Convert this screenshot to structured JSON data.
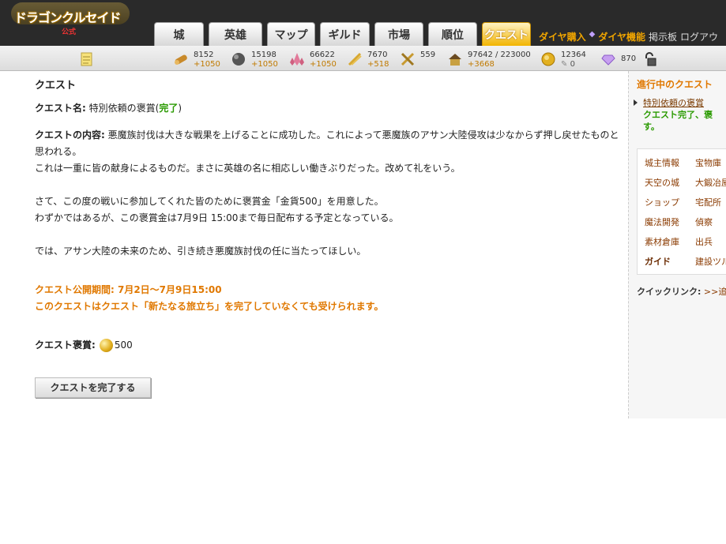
{
  "header": {
    "logo_text": "ドラゴンクルセイド",
    "logo_sub": "公式",
    "tabs": [
      "城",
      "英雄",
      "マップ",
      "ギルド",
      "市場",
      "順位",
      "クエスト"
    ],
    "active_tab": "クエスト",
    "links": {
      "buy_diamond": "ダイヤ購入",
      "diamond_feature": "ダイヤ機能",
      "bbs": "掲示板",
      "logout": "ログアウ"
    }
  },
  "resources": {
    "wood": {
      "amount": "8152",
      "rate": "+1050"
    },
    "stone": {
      "amount": "15198",
      "rate": "+1050"
    },
    "crystal": {
      "amount": "66622",
      "rate": "+1050"
    },
    "grain": {
      "amount": "7670",
      "rate": "+518"
    },
    "grain_stock": {
      "amount": "559"
    },
    "population": {
      "amount": "97642 / 223000",
      "rate": "+3668"
    },
    "gold": {
      "amount": "12364",
      "rate": "0"
    },
    "diamond": {
      "amount": "870"
    }
  },
  "main": {
    "page_title": "クエスト",
    "quest_name_label": "クエスト名:",
    "quest_name": "特別依頼の褒賞",
    "status_open": "(",
    "status": "完了",
    "status_close": ")",
    "content_label": "クエストの内容:",
    "content_p1": "悪魔族討伐は大きな戦果を上げることに成功した。これによって悪魔族のアサン大陸侵攻は少なからず押し戻せたものと思われる。",
    "content_p2": "これは一重に皆の献身によるものだ。まさに英雄の名に相応しい働きぶりだった。改めて礼をいう。",
    "content_p3": "さて、この度の戦いに参加してくれた皆のために褒賞金「金貨500」を用意した。",
    "content_p4": "わずかではあるが、この褒賞金は7月9日 15:00まで毎日配布する予定となっている。",
    "content_p5": "では、アサン大陸の未来のため、引き続き悪魔族討伐の任に当たってほしい。",
    "period": "クエスト公開期間: 7月2日～7月9日15:00",
    "note": "このクエストはクエスト「新たなる旅立ち」を完了していなくても受けられます。",
    "reward_label": "クエスト褒賞:",
    "reward_value": "500",
    "complete_button": "クエストを完了する"
  },
  "sidebar": {
    "title": "進行中のクエスト",
    "quest_link": "特別依頼の褒賞",
    "quest_done_1": "クエスト完了、褒",
    "quest_done_2": "す。",
    "menu": [
      "城主情報",
      "宝物庫",
      "天空の城",
      "大鍛冶屋",
      "ショップ",
      "宅配所",
      "魔法開発",
      "偵察",
      "素材倉庫",
      "出兵",
      "ガイド",
      "建設ツル"
    ],
    "quicklink_label": "クイックリンク:",
    "quicklink_add": ">>追加"
  },
  "colors": {
    "accent_orange": "#e07800",
    "done_green": "#2a9a00",
    "header_bg": "#2a2a2a"
  },
  "icons": [
    "memo-icon",
    "wood-icon",
    "stone-icon",
    "crystal-icon",
    "grain-icon",
    "grain-stock-icon",
    "population-icon",
    "gold-coin-icon",
    "diamond-icon",
    "lock-icon"
  ]
}
